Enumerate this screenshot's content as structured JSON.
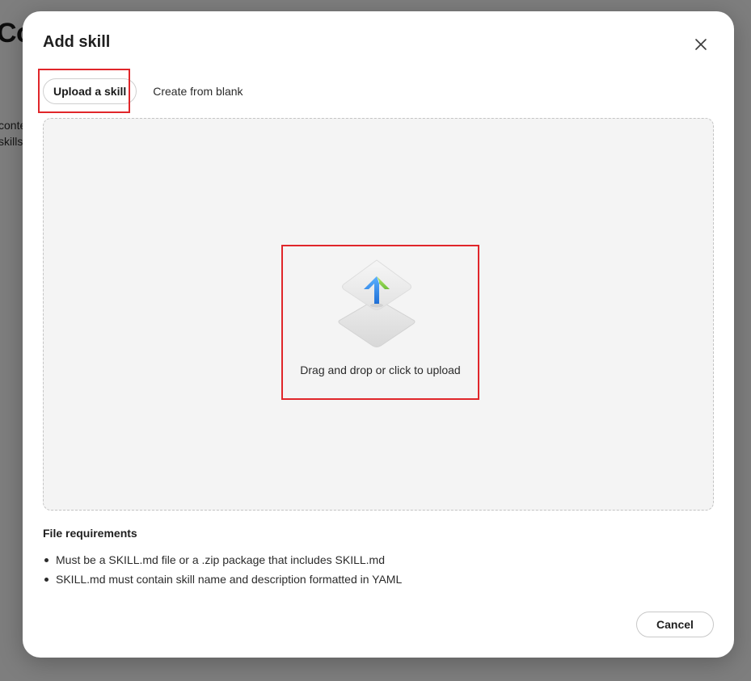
{
  "background": {
    "heading_fragment": "Co",
    "line1_fragment": "conte",
    "line2_fragment": "skills,"
  },
  "modal": {
    "title": "Add skill",
    "close_icon": "close-icon"
  },
  "tabs": [
    {
      "label": "Upload a skill",
      "active": true
    },
    {
      "label": "Create from blank",
      "active": false
    }
  ],
  "dropzone": {
    "icon": "upload-icon",
    "text": "Drag and drop or click to upload"
  },
  "requirements": {
    "title": "File requirements",
    "items": [
      "Must be a SKILL.md file or a .zip package that includes SKILL.md",
      "SKILL.md must contain skill name and description formatted in YAML"
    ]
  },
  "footer": {
    "cancel_label": "Cancel"
  },
  "colors": {
    "highlight": "#e0262a",
    "arrow_blue": "#2f8cf0",
    "arrow_green": "#8fd14f"
  }
}
